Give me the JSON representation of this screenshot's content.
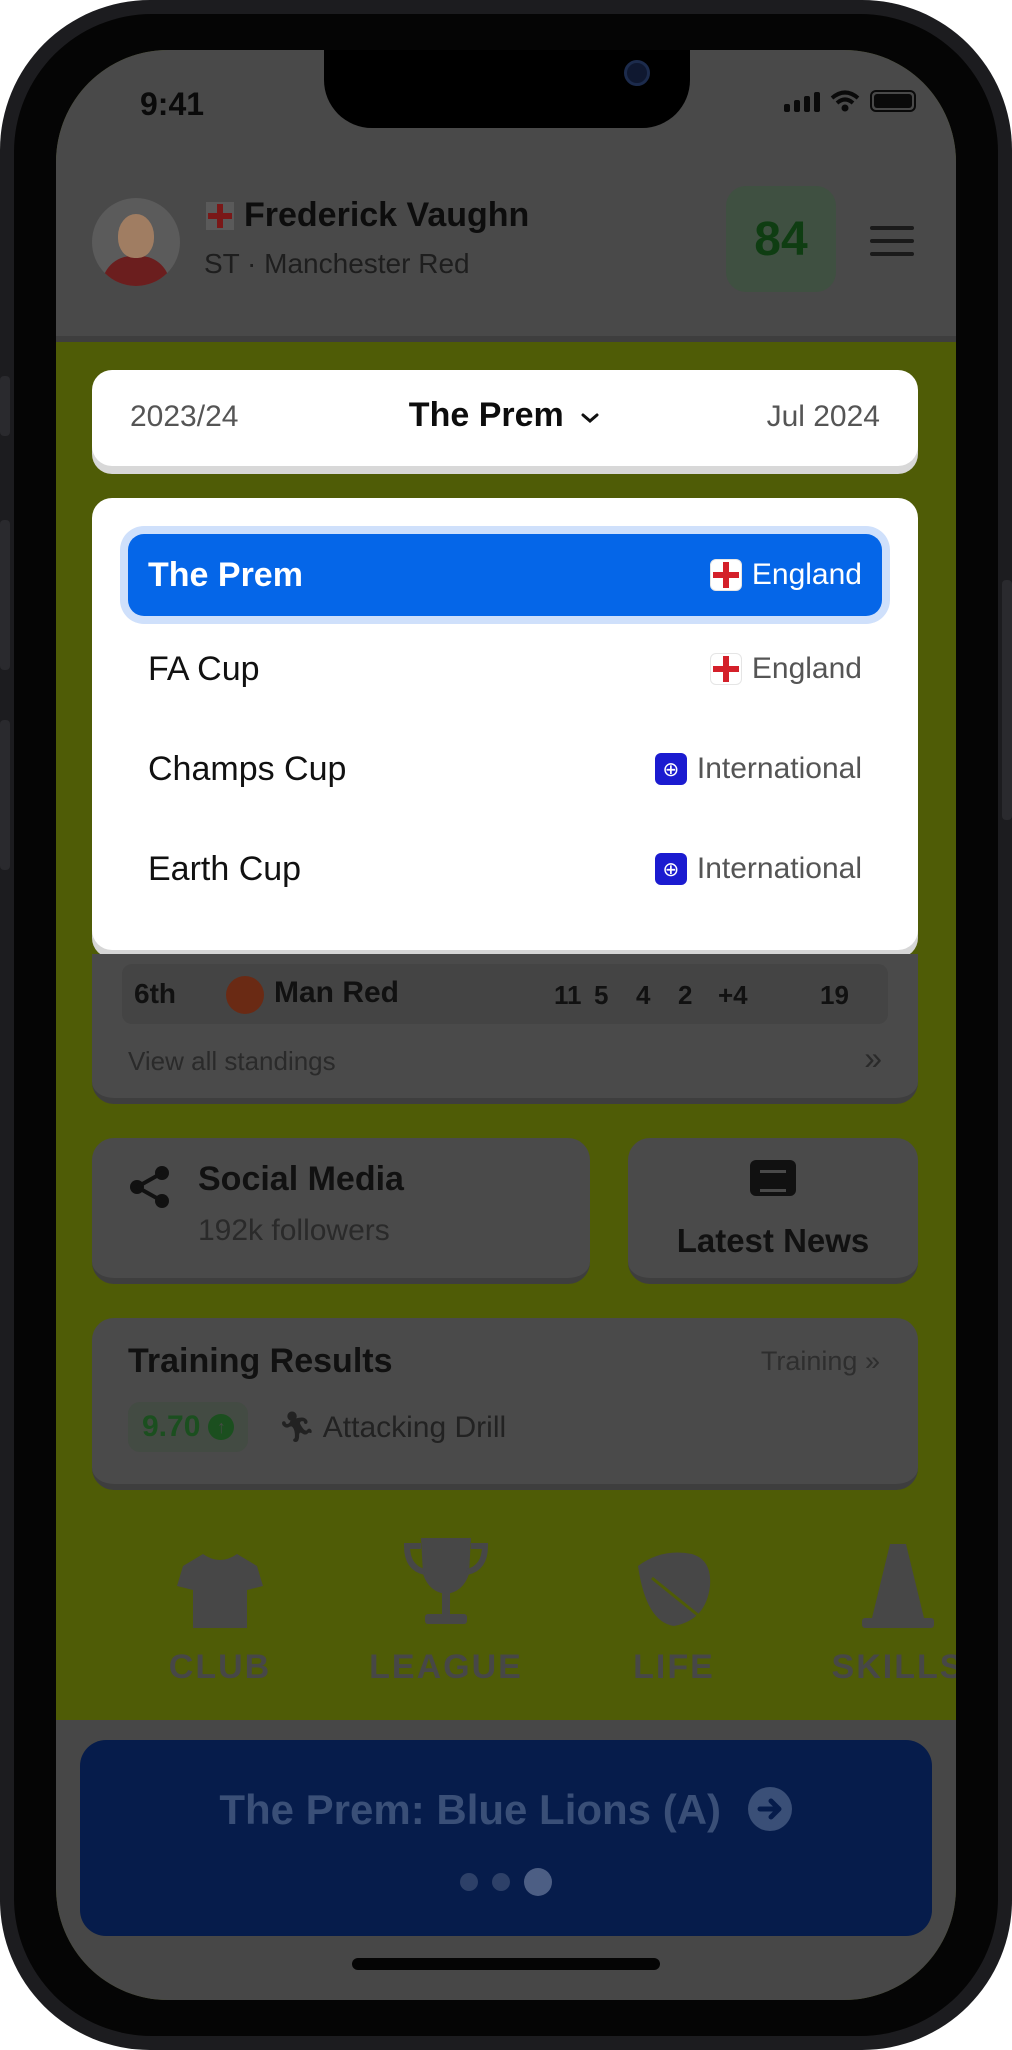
{
  "status_bar": {
    "time": "9:41"
  },
  "player": {
    "name": "Frederick Vaughn",
    "subtitle": "ST · Manchester Red",
    "rating": "84"
  },
  "season_bar": {
    "season": "2023/24",
    "competition": "The Prem",
    "date": "Jul 2024"
  },
  "dropdown": {
    "options": [
      {
        "name": "The Prem",
        "region": "England",
        "selected": true
      },
      {
        "name": "FA Cup",
        "region": "England",
        "selected": false
      },
      {
        "name": "Champs Cup",
        "region": "International",
        "selected": false
      },
      {
        "name": "Earth Cup",
        "region": "International",
        "selected": false
      }
    ]
  },
  "standings": {
    "row": {
      "position": "6th",
      "team": "Man Red",
      "played": "11",
      "won": "5",
      "drawn": "4",
      "lost": "2",
      "goal_diff": "+4",
      "points": "19"
    },
    "view_all": "View all standings"
  },
  "social": {
    "title": "Social Media",
    "followers": "192k followers"
  },
  "news": {
    "title": "Latest News"
  },
  "training": {
    "title": "Training Results",
    "link": "Training",
    "score": "9.70",
    "drill": "Attacking Drill"
  },
  "tabs": [
    {
      "label": "CLUB",
      "icon": "shirt-icon"
    },
    {
      "label": "LEAGUE",
      "icon": "trophy-icon"
    },
    {
      "label": "LIFE",
      "icon": "leaf-icon"
    },
    {
      "label": "SKILLS",
      "icon": "cone-icon"
    }
  ],
  "banner": {
    "text": "The Prem: Blue Lions (A)",
    "page_count": 3,
    "active_page": 3
  },
  "colors": {
    "accent": "#0566e8",
    "background": "#4f5c06",
    "banner": "#061c4b"
  }
}
